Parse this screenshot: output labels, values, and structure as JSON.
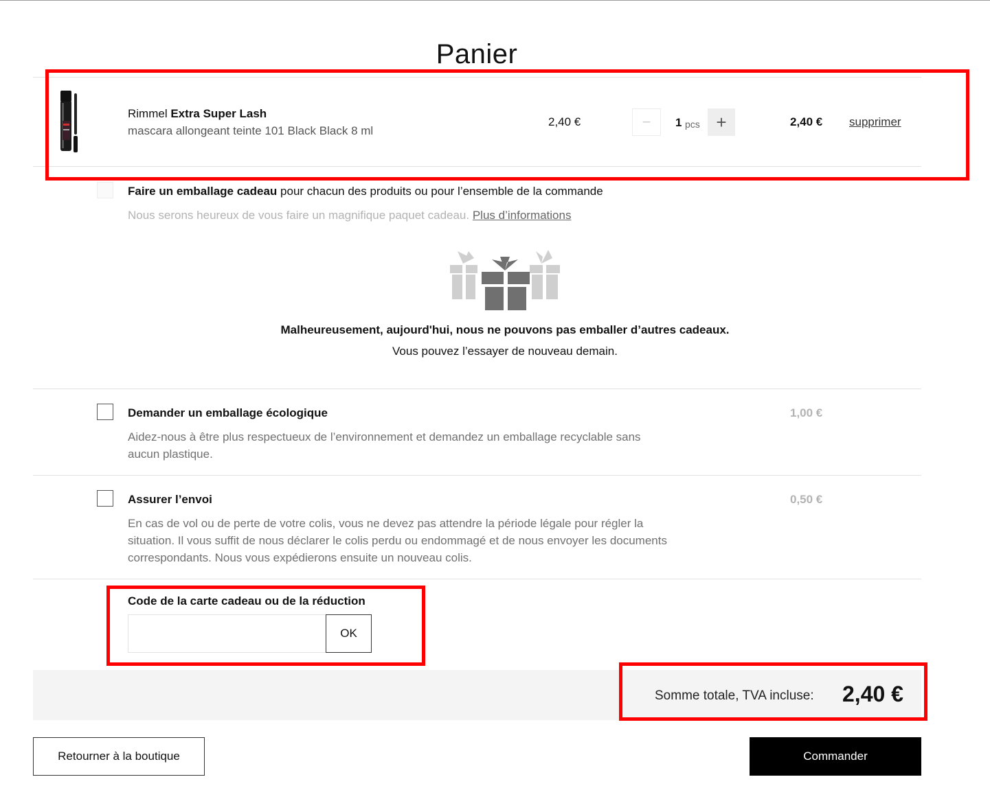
{
  "page": {
    "title": "Panier"
  },
  "item": {
    "brand": "Rimmel",
    "name": "Extra Super Lash",
    "description": "mascara allongeant teinte 101 Black Black 8 ml",
    "unit_price": "2,40 €",
    "quantity": "1",
    "quantity_unit": "pcs",
    "minus_symbol": "−",
    "plus_symbol": "+",
    "total": "2,40 €",
    "remove_label": "supprimer"
  },
  "gift_wrap": {
    "title_bold": "Faire un emballage cadeau",
    "title_rest": " pour chacun des produits ou pour l’ensemble de la commande",
    "description": "Nous serons heureux de vous faire un magnifique paquet cadeau. ",
    "more_info": "Plus d’informations",
    "unavailable_title": "Malheureusement, aujourd'hui, nous ne pouvons pas emballer d’autres cadeaux.",
    "unavailable_subtitle": "Vous pouvez l’essayer de nouveau demain.",
    "icon": "gift-boxes-icon"
  },
  "eco_packaging": {
    "title": "Demander un emballage écologique",
    "description_line1": "Aidez-nous à être plus respectueux de l’environnement et demandez un emballage recyclable sans",
    "description_line2": "aucun plastique.",
    "price": "1,00 €",
    "checked": false
  },
  "insurance": {
    "title": "Assurer l’envoi",
    "description_line1": "En cas de vol ou de perte de votre colis, vous ne devez pas attendre la période légale pour régler la",
    "description_line2": "situation. Il vous suffit de nous déclarer le colis perdu ou endommagé et de nous envoyer les documents",
    "description_line3": "correspondants. Nous vous expédierons ensuite un nouveau colis.",
    "price": "0,50 €",
    "checked": false
  },
  "voucher": {
    "label": "Code de la carte cadeau ou de la réduction",
    "value": "",
    "placeholder": "",
    "button_label": "OK"
  },
  "summary": {
    "total_label": "Somme totale, TVA incluse:",
    "total_value": "2,40 €"
  },
  "actions": {
    "back_label": "Retourner à la boutique",
    "order_label": "Commander"
  },
  "colors": {
    "highlight": "#ff0000",
    "primary_button": "#000000",
    "summary_background": "#f4f4f4"
  }
}
